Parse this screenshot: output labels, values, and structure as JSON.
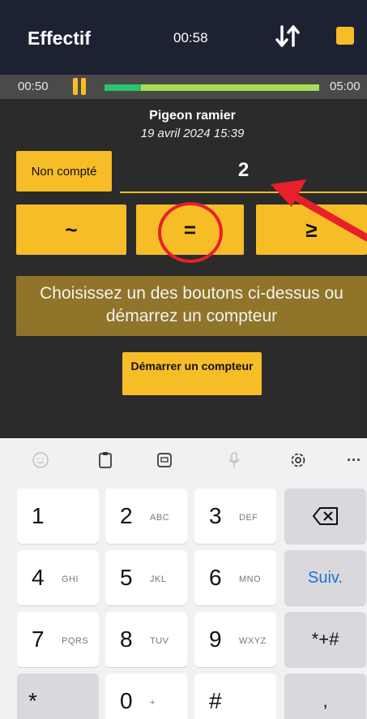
{
  "header": {
    "title": "Effectif",
    "clock": "00:58",
    "sort_icon": "sort-arrows-icon",
    "stop_icon": "stop-icon",
    "accent": "#f7bd27",
    "bar_color": "#1d2233"
  },
  "timer": {
    "elapsed": "00:50",
    "total": "05:00",
    "progress_fraction": 0.17,
    "pause_icon": "pause-icon"
  },
  "observation": {
    "species": "Pigeon ramier",
    "datetime": "19 avril 2024 15:39"
  },
  "count": {
    "not_counted_label": "Non compté",
    "value": "2"
  },
  "operators": {
    "approx": "~",
    "equal": "=",
    "gte": "≥"
  },
  "hint": "Choisissez un des boutons ci-dessus ou démarrez un compteur",
  "start_counter": {
    "label": "Démarrer un compteur"
  },
  "keyboard": {
    "toolbar": [
      "emoji-icon",
      "clipboard-icon",
      "sticker-icon",
      "microphone-icon",
      "settings-icon",
      "more-icon"
    ],
    "more_label": "···",
    "keys": {
      "k1": {
        "num": "1",
        "sub": ""
      },
      "k2": {
        "num": "2",
        "sub": "ABC"
      },
      "k3": {
        "num": "3",
        "sub": "DEF"
      },
      "k4": {
        "num": "4",
        "sub": "GHI"
      },
      "k5": {
        "num": "5",
        "sub": "JKL"
      },
      "k6": {
        "num": "6",
        "sub": "MNO"
      },
      "k7": {
        "num": "7",
        "sub": "PQRS"
      },
      "k8": {
        "num": "8",
        "sub": "TUV"
      },
      "k9": {
        "num": "9",
        "sub": "WXYZ"
      },
      "k0": {
        "num": "0",
        "sub": "+"
      }
    },
    "next_label": "Suiv.",
    "symbols_label": "*+#",
    "star_label": "*",
    "hash_label": "#",
    "comma_label": ","
  }
}
